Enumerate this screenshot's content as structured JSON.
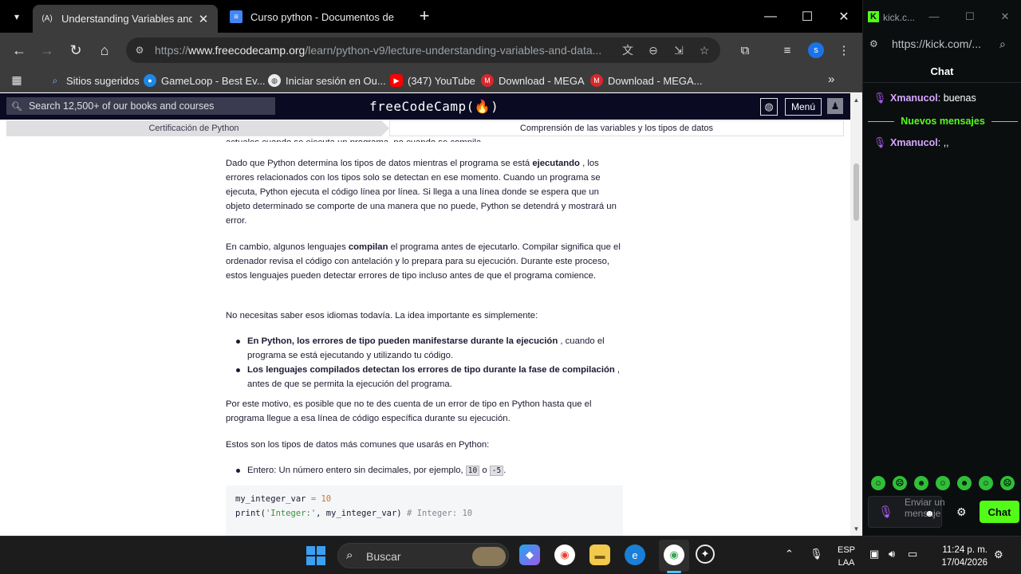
{
  "browser": {
    "tabs": [
      {
        "title": "Understanding Variables and Da",
        "favicon": "(A)"
      },
      {
        "title": "Curso python - Documentos de",
        "favicon": "doc-icon"
      }
    ],
    "url_prefix": "https://",
    "url_host": "www.freecodecamp.org",
    "url_path": "/learn/python-v9/lecture-understanding-variables-and-data...",
    "profile_initial": "s",
    "bookmarks": [
      {
        "label": "Sitios sugeridos"
      },
      {
        "label": "GameLoop - Best Ev..."
      },
      {
        "label": "Iniciar sesión en Ou..."
      },
      {
        "label": "(347) YouTube"
      },
      {
        "label": "Download - MEGA"
      },
      {
        "label": "Download - MEGA..."
      }
    ]
  },
  "fcc": {
    "search_placeholder": "Search 12,500+ of our books and courses",
    "logo": "freeCodeCamp(🔥)",
    "menu_label": "Menú",
    "breadcrumb": {
      "course": "Certificación de Python",
      "lesson": "Comprensión de las variables y los tipos de datos"
    }
  },
  "article": {
    "cut_text": "actuales cuando se ejecuta un programa, no cuando se compila.",
    "p1_a": "Dado que Python determina los tipos de datos mientras el programa se está ",
    "p1_b": "ejecutando",
    "p1_c": " , los errores relacionados con los tipos solo se detectan en ese momento. Cuando un programa se ejecuta, Python ejecuta el código línea por línea. Si llega a una línea donde se espera que un objeto determinado se comporte de una manera que no puede, Python se detendrá y mostrará un error.",
    "p2_a": "En cambio, algunos lenguajes ",
    "p2_b": "compilan",
    "p2_c": " el programa antes de ejecutarlo. Compilar significa que el ordenador revisa el código con antelación y lo prepara para su ejecución. Durante este proceso, estos lenguajes pueden detectar errores de tipo incluso antes de que el programa comience.",
    "p3": "No necesitas saber esos idiomas todavía. La idea importante es simplemente:",
    "li1_b": "En Python, los errores de tipo pueden manifestarse durante la ejecución",
    "li1_c": " , cuando el programa se está ejecutando y utilizando tu código.",
    "li2_b": "Los lenguajes compilados detectan los errores de tipo durante la fase de compilación",
    "li2_c": " , antes de que se permita la ejecución del programa.",
    "p4": "Por este motivo, es posible que no te des cuenta de un error de tipo en Python hasta que el programa llegue a esa línea de código específica durante su ejecución.",
    "p5": "Estos son los tipos de datos más comunes que usarás en Python:",
    "li3_a": "Entero: Un número entero sin decimales, por ejemplo, ",
    "li3_code1": "10",
    "li3_mid": " o ",
    "li3_code2": "-5",
    "li3_end": ".",
    "code_l1_var": "my_integer_var",
    "code_l1_eq": " = ",
    "code_l1_num": "10",
    "code_l2_fn": "print(",
    "code_l2_str": "'Integer:'",
    "code_l2_rest": ", my_integer_var) ",
    "code_l2_cmt": "# Integer: 10"
  },
  "kick": {
    "tab_title": "kick.c...",
    "url": "https://kick.com/...",
    "header": "Chat",
    "messages": [
      {
        "user": "Xmanucol",
        "text": ": buenas"
      },
      {
        "user": "Xmanucol",
        "text": ": ,,"
      }
    ],
    "new_messages": "Nuevos mensajes",
    "input_placeholder": "Enviar un mensaje",
    "chat_button": "Chat"
  },
  "taskbar": {
    "search": "Buscar",
    "lang_line1": "ESP",
    "lang_line2": "LAA",
    "time": "11:24 p. m.",
    "date": "17/04/2026"
  },
  "colors": {
    "fcc_nav": "#0a0a23",
    "kick_green": "#53fc18",
    "kick_user": "#d8a8ff"
  }
}
